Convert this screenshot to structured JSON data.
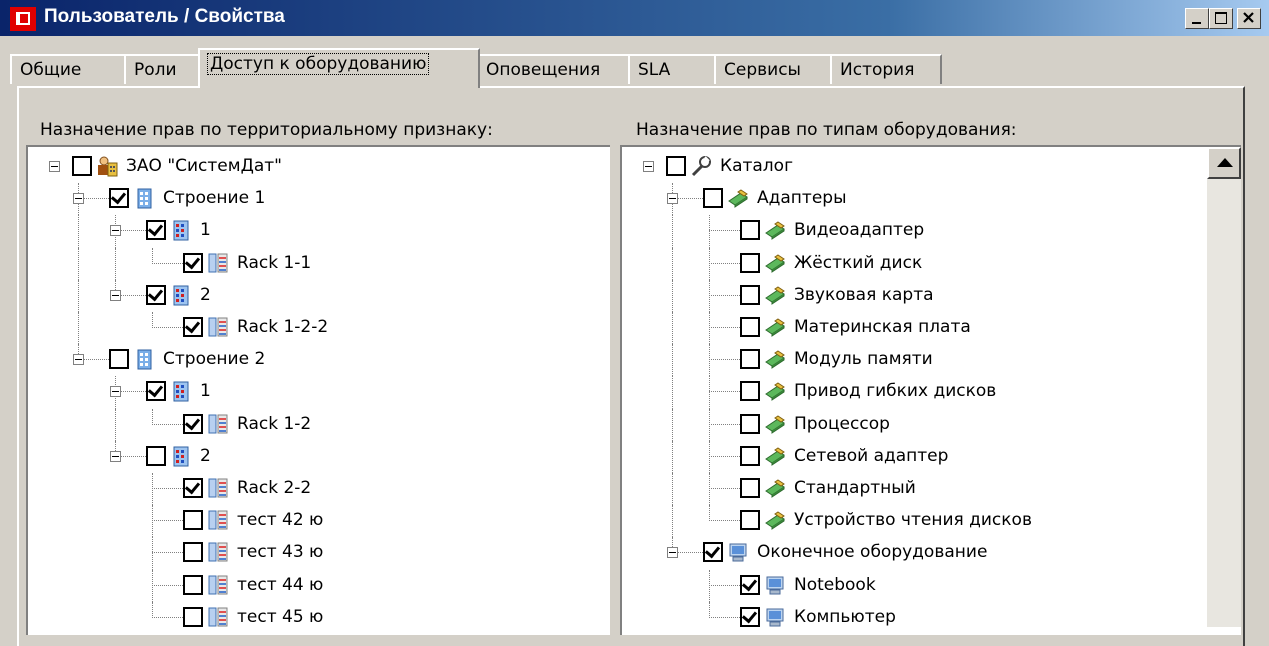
{
  "window": {
    "title": "Пользователь / Свойства",
    "app_icon": "lm-app-icon"
  },
  "tabs": [
    {
      "label": "Общие",
      "active": false
    },
    {
      "label": "Роли",
      "active": false
    },
    {
      "label": "Доступ к оборудованию",
      "active": true
    },
    {
      "label": "Оповещения",
      "active": false
    },
    {
      "label": "SLA",
      "active": false
    },
    {
      "label": "Сервисы",
      "active": false
    },
    {
      "label": "История",
      "active": false
    }
  ],
  "left_panel": {
    "heading": "Назначение прав по территориальному признаку:",
    "nodes": [
      {
        "label": "ЗАО \"СистемДат\"",
        "level": 0,
        "checked": false,
        "icon": "org-user-icon",
        "expanded": true
      },
      {
        "label": "Строение 1",
        "level": 1,
        "checked": true,
        "icon": "building-icon",
        "expanded": true
      },
      {
        "label": "1",
        "level": 2,
        "checked": true,
        "icon": "floor-icon",
        "expanded": true
      },
      {
        "label": "Rack 1-1",
        "level": 3,
        "checked": true,
        "icon": "rack-icon"
      },
      {
        "label": "2",
        "level": 2,
        "checked": true,
        "icon": "floor-icon",
        "expanded": true
      },
      {
        "label": "Rack 1-2-2",
        "level": 3,
        "checked": true,
        "icon": "rack-icon"
      },
      {
        "label": "Строение 2",
        "level": 1,
        "checked": false,
        "icon": "building-icon",
        "expanded": true
      },
      {
        "label": "1",
        "level": 2,
        "checked": true,
        "icon": "floor-icon",
        "expanded": true
      },
      {
        "label": "Rack 1-2",
        "level": 3,
        "checked": true,
        "icon": "rack-icon"
      },
      {
        "label": "2",
        "level": 2,
        "checked": false,
        "icon": "floor-icon",
        "expanded": true
      },
      {
        "label": "Rack 2-2",
        "level": 3,
        "checked": true,
        "icon": "rack-icon"
      },
      {
        "label": "тест 42 ю",
        "level": 3,
        "checked": false,
        "icon": "rack-icon"
      },
      {
        "label": "тест 43 ю",
        "level": 3,
        "checked": false,
        "icon": "rack-icon"
      },
      {
        "label": "тест 44 ю",
        "level": 3,
        "checked": false,
        "icon": "rack-icon"
      },
      {
        "label": "тест 45 ю",
        "level": 3,
        "checked": false,
        "icon": "rack-icon"
      }
    ]
  },
  "right_panel": {
    "heading": "Назначение прав по типам оборудования:",
    "nodes": [
      {
        "label": "Каталог",
        "level": 0,
        "checked": false,
        "icon": "wrench-icon",
        "expanded": true
      },
      {
        "label": "Адаптеры",
        "level": 1,
        "checked": false,
        "icon": "adapter-card-icon",
        "expanded": true
      },
      {
        "label": "Видеоадаптер",
        "level": 2,
        "checked": false,
        "icon": "adapter-card-icon"
      },
      {
        "label": "Жёсткий диск",
        "level": 2,
        "checked": false,
        "icon": "adapter-card-icon"
      },
      {
        "label": "Звуковая карта",
        "level": 2,
        "checked": false,
        "icon": "adapter-card-icon"
      },
      {
        "label": "Материнская плата",
        "level": 2,
        "checked": false,
        "icon": "adapter-card-icon"
      },
      {
        "label": "Модуль памяти",
        "level": 2,
        "checked": false,
        "icon": "adapter-card-icon"
      },
      {
        "label": "Привод гибких дисков",
        "level": 2,
        "checked": false,
        "icon": "adapter-card-icon"
      },
      {
        "label": "Процессор",
        "level": 2,
        "checked": false,
        "icon": "adapter-card-icon"
      },
      {
        "label": "Сетевой адаптер",
        "level": 2,
        "checked": false,
        "icon": "adapter-card-icon"
      },
      {
        "label": "Стандартный",
        "level": 2,
        "checked": false,
        "icon": "adapter-card-icon"
      },
      {
        "label": "Устройство чтения дисков",
        "level": 2,
        "checked": false,
        "icon": "adapter-card-icon"
      },
      {
        "label": "Оконечное оборудование",
        "level": 1,
        "checked": true,
        "icon": "monitor-icon",
        "expanded": true
      },
      {
        "label": "Notebook",
        "level": 2,
        "checked": true,
        "icon": "monitor-icon"
      },
      {
        "label": "Компьютер",
        "level": 2,
        "checked": true,
        "icon": "monitor-icon"
      }
    ]
  },
  "colors": {
    "title_gradient_start": "#0a246a",
    "title_gradient_end": "#a6caf0",
    "face": "#d4d0c8",
    "adapter_green": "#4caf50"
  }
}
